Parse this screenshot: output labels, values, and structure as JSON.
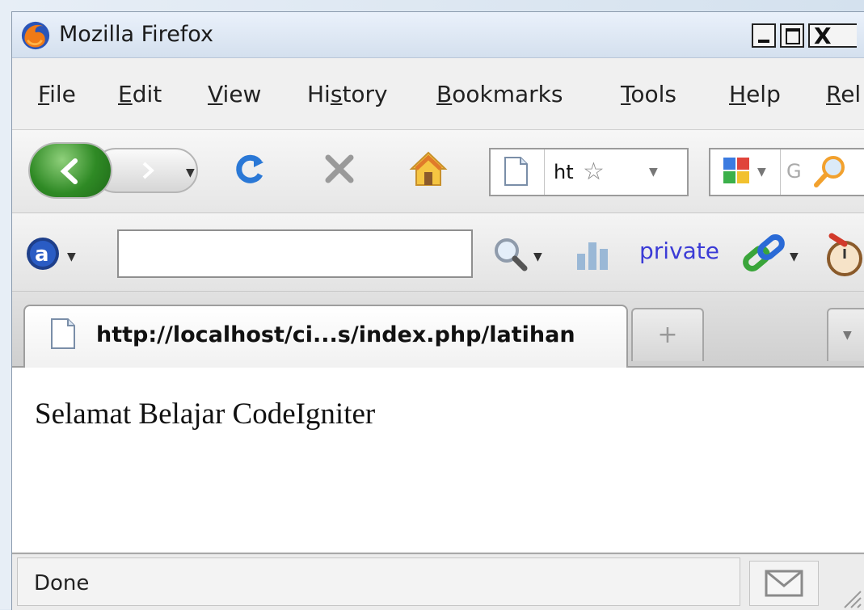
{
  "window": {
    "title": "Mozilla Firefox",
    "close_glyph": "X"
  },
  "menu": [
    {
      "label": "File",
      "mnemonic": "F",
      "rest": "ile"
    },
    {
      "label": "Edit",
      "mnemonic": "E",
      "rest": "dit"
    },
    {
      "label": "View",
      "mnemonic": "V",
      "rest": "iew"
    },
    {
      "label": "History",
      "pre": "Hi",
      "mnemonic": "s",
      "rest": "tory"
    },
    {
      "label": "Bookmarks",
      "mnemonic": "B",
      "rest": "ookmarks"
    },
    {
      "label": "Tools",
      "mnemonic": "T",
      "rest": "ools"
    },
    {
      "label": "Help",
      "mnemonic": "H",
      "rest": "elp"
    },
    {
      "label": "Rel",
      "mnemonic": "R",
      "rest": "el"
    }
  ],
  "navbar": {
    "url_text": "ht",
    "search_placeholder": "G"
  },
  "toolbar2": {
    "private_label": "private"
  },
  "tabs": [
    {
      "label": "http://localhost/ci...s/index.php/latihan"
    }
  ],
  "newtab_glyph": "+",
  "content": {
    "text": "Selamat Belajar CodeIgniter"
  },
  "status": {
    "text": "Done"
  },
  "icons": {
    "app": "firefox-icon",
    "back": "back-arrow-icon",
    "forward": "forward-arrow-icon",
    "reload": "reload-icon",
    "stop": "stop-icon",
    "home": "home-icon",
    "page": "page-icon",
    "star": "bookmark-star-icon",
    "engine": "search-engine-icon",
    "magnifier": "magnifier-icon",
    "ask": "ask-logo-icon",
    "bars": "bar-chart-icon",
    "chain": "link-chain-icon",
    "timer": "stopwatch-icon",
    "mail": "gmail-icon"
  }
}
